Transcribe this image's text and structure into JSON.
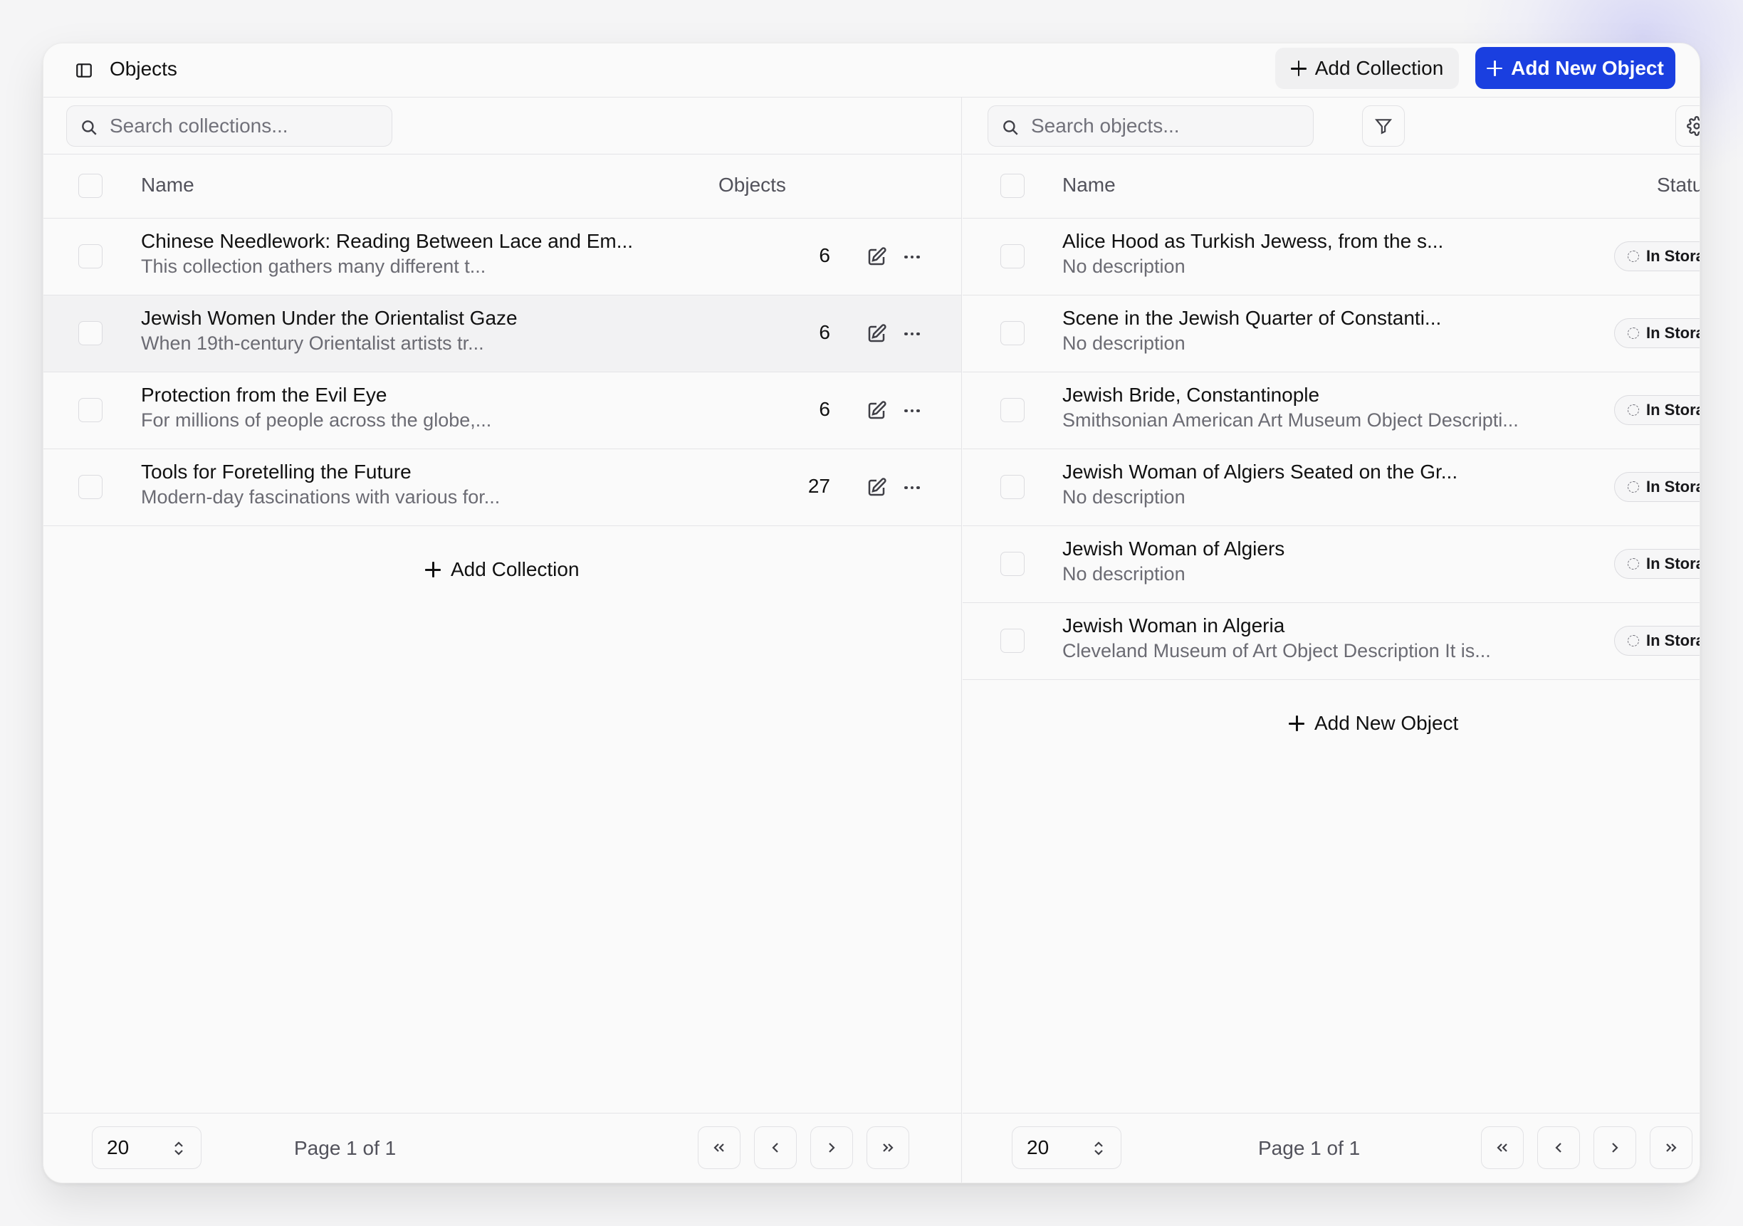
{
  "header": {
    "title": "Objects",
    "add_collection_label": "Add Collection",
    "add_object_label": "Add New Object"
  },
  "collections": {
    "search_placeholder": "Search collections...",
    "columns": {
      "name": "Name",
      "objects": "Objects"
    },
    "rows": [
      {
        "title": "Chinese Needlework: Reading Between Lace and Em...",
        "description": "This collection gathers many different t...",
        "count": "6"
      },
      {
        "title": "Jewish Women Under the Orientalist Gaze",
        "description": "When 19th-century Orientalist artists tr...",
        "count": "6"
      },
      {
        "title": "Protection from the Evil Eye",
        "description": "For millions of people across the globe,...",
        "count": "6"
      },
      {
        "title": "Tools for Foretelling the Future",
        "description": "Modern-day fascinations with various for...",
        "count": "27"
      }
    ],
    "add_label": "Add Collection",
    "page_size": "20",
    "page_label": "Page 1 of 1"
  },
  "objects": {
    "search_placeholder": "Search objects...",
    "columns": {
      "name": "Name",
      "status": "Status"
    },
    "rows": [
      {
        "title": "Alice Hood as Turkish Jewess, from the s...",
        "description": "No description",
        "status": "In Storage"
      },
      {
        "title": "Scene in the Jewish Quarter of Constanti...",
        "description": "No description",
        "status": "In Storage"
      },
      {
        "title": "Jewish Bride, Constantinople",
        "description": "Smithsonian American Art Museum Object Descripti...",
        "status": "In Storage"
      },
      {
        "title": "Jewish Woman of Algiers Seated on the Gr...",
        "description": "No description",
        "status": "In Storage"
      },
      {
        "title": "Jewish Woman of Algiers",
        "description": "No description",
        "status": "In Storage"
      },
      {
        "title": "Jewish Woman in Algeria",
        "description": "Cleveland Museum of Art Object Description It is...",
        "status": "In Storage"
      }
    ],
    "add_label": "Add New Object",
    "page_size": "20",
    "page_label": "Page 1 of 1"
  },
  "icons": {
    "sidebar_toggle": "sidebar-icon",
    "search": "search-icon",
    "filter": "filter-icon",
    "settings": "gear-icon",
    "edit": "pencil-icon",
    "more": "ellipsis-icon",
    "first": "chevrons-left-icon",
    "prev": "chevron-left-icon",
    "next": "chevron-right-icon",
    "last": "chevrons-right-icon"
  },
  "colors": {
    "primary": "#1a3fe0",
    "border": "#e4e4e7",
    "muted_text": "#6b6b73"
  }
}
